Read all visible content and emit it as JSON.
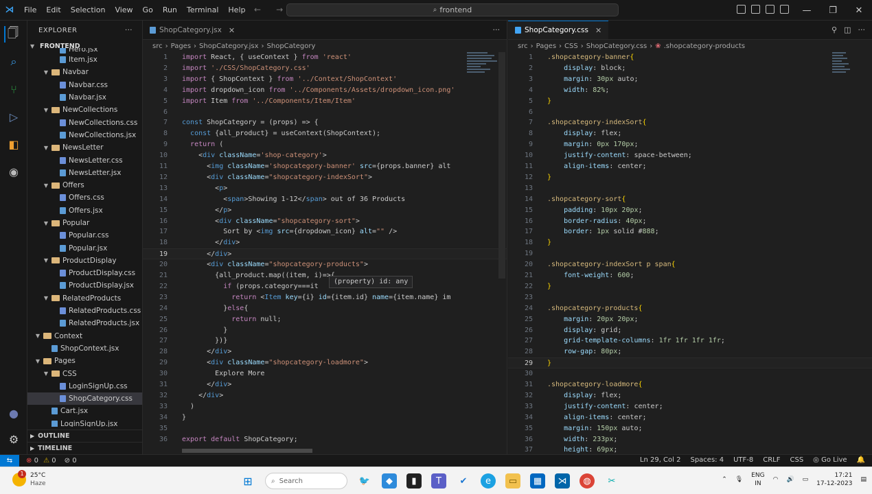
{
  "titlebar": {
    "menu": [
      "File",
      "Edit",
      "Selection",
      "View",
      "Go",
      "Run",
      "Terminal",
      "Help"
    ],
    "command_center": "frontend"
  },
  "sidebar": {
    "title": "EXPLORER",
    "root": "FRONTEND",
    "tree": [
      {
        "label": "Hero.jsx",
        "type": "js",
        "depth": 2,
        "partial": true
      },
      {
        "label": "Item.jsx",
        "type": "js",
        "depth": 2
      },
      {
        "label": "Navbar",
        "type": "folder",
        "depth": 1
      },
      {
        "label": "Navbar.css",
        "type": "css",
        "depth": 2
      },
      {
        "label": "Navbar.jsx",
        "type": "js",
        "depth": 2
      },
      {
        "label": "NewCollections",
        "type": "folder",
        "depth": 1
      },
      {
        "label": "NewCollections.css",
        "type": "css",
        "depth": 2
      },
      {
        "label": "NewCollections.jsx",
        "type": "js",
        "depth": 2
      },
      {
        "label": "NewsLetter",
        "type": "folder",
        "depth": 1
      },
      {
        "label": "NewsLetter.css",
        "type": "css",
        "depth": 2
      },
      {
        "label": "NewsLetter.jsx",
        "type": "js",
        "depth": 2
      },
      {
        "label": "Offers",
        "type": "folder",
        "depth": 1
      },
      {
        "label": "Offers.css",
        "type": "css",
        "depth": 2
      },
      {
        "label": "Offers.jsx",
        "type": "js",
        "depth": 2
      },
      {
        "label": "Popular",
        "type": "folder",
        "depth": 1
      },
      {
        "label": "Popular.css",
        "type": "css",
        "depth": 2
      },
      {
        "label": "Popular.jsx",
        "type": "js",
        "depth": 2
      },
      {
        "label": "ProductDisplay",
        "type": "folder",
        "depth": 1
      },
      {
        "label": "ProductDisplay.css",
        "type": "css",
        "depth": 2
      },
      {
        "label": "ProductDisplay.jsx",
        "type": "js",
        "depth": 2
      },
      {
        "label": "RelatedProducts",
        "type": "folder",
        "depth": 1
      },
      {
        "label": "RelatedProducts.css",
        "type": "css",
        "depth": 2
      },
      {
        "label": "RelatedProducts.jsx",
        "type": "js",
        "depth": 2
      },
      {
        "label": "Context",
        "type": "folder",
        "depth": 0
      },
      {
        "label": "ShopContext.jsx",
        "type": "js",
        "depth": 1
      },
      {
        "label": "Pages",
        "type": "folder",
        "depth": 0
      },
      {
        "label": "CSS",
        "type": "folder",
        "depth": 1
      },
      {
        "label": "LoginSignUp.css",
        "type": "css",
        "depth": 2
      },
      {
        "label": "ShopCategory.css",
        "type": "css",
        "depth": 2,
        "selected": true
      },
      {
        "label": "Cart.jsx",
        "type": "js",
        "depth": 1
      },
      {
        "label": "LoginSignUp.jsx",
        "type": "js",
        "depth": 1,
        "partial": true
      }
    ],
    "outline": "OUTLINE",
    "timeline": "TIMELINE"
  },
  "editor_left": {
    "tab": "ShopCategory.jsx",
    "breadcrumb": [
      "src",
      "Pages",
      "ShopCategory.jsx",
      "ShopCategory"
    ],
    "hover": "(property) id: any",
    "lines": [
      {
        "n": "1",
        "t": "import React, { useContext } from 'react'"
      },
      {
        "n": "2",
        "t": "import './CSS/ShopCategory.css'"
      },
      {
        "n": "3",
        "t": "import { ShopContext } from '../Context/ShopContext'"
      },
      {
        "n": "4",
        "t": "import dropdown_icon from '../Components/Assets/dropdown_icon.png'"
      },
      {
        "n": "5",
        "t": "import Item from '../Components/Item/Item'"
      },
      {
        "n": "6",
        "t": ""
      },
      {
        "n": "7",
        "t": "const ShopCategory = (props) => {"
      },
      {
        "n": "8",
        "t": "  const {all_product} = useContext(ShopContext);"
      },
      {
        "n": "9",
        "t": "  return ("
      },
      {
        "n": "10",
        "t": "    <div className='shop-category'>"
      },
      {
        "n": "11",
        "t": "      <img className='shopcategory-banner' src={props.banner} alt"
      },
      {
        "n": "12",
        "t": "      <div className=\"shopcategory-indexSort\">"
      },
      {
        "n": "13",
        "t": "        <p>"
      },
      {
        "n": "14",
        "t": "          <span>Showing 1-12</span> out of 36 Products"
      },
      {
        "n": "15",
        "t": "        </p>"
      },
      {
        "n": "16",
        "t": "        <div className=\"shopcategory-sort\">"
      },
      {
        "n": "17",
        "t": "          Sort by <img src={dropdown_icon} alt=\"\" />"
      },
      {
        "n": "18",
        "t": "        </div>"
      },
      {
        "n": "19",
        "t": "      </div>"
      },
      {
        "n": "20",
        "t": "      <div className=\"shopcategory-products\">"
      },
      {
        "n": "21",
        "t": "        {all_product.map((item, i)=>{"
      },
      {
        "n": "22",
        "t": "          if (props.category===it"
      },
      {
        "n": "23",
        "t": "            return <Item key={i} id={item.id} name={item.name} im"
      },
      {
        "n": "24",
        "t": "          }else{"
      },
      {
        "n": "25",
        "t": "            return null;"
      },
      {
        "n": "26",
        "t": "          }"
      },
      {
        "n": "27",
        "t": "        })}"
      },
      {
        "n": "28",
        "t": "      </div>"
      },
      {
        "n": "29",
        "t": "      <div className=\"shopcategory-loadmore\">"
      },
      {
        "n": "30",
        "t": "        Explore More"
      },
      {
        "n": "31",
        "t": "      </div>"
      },
      {
        "n": "32",
        "t": "    </div>"
      },
      {
        "n": "33",
        "t": "  )"
      },
      {
        "n": "34",
        "t": "}"
      },
      {
        "n": "35",
        "t": ""
      },
      {
        "n": "36",
        "t": "export default ShopCategory;"
      }
    ]
  },
  "editor_right": {
    "tab": "ShopCategory.css",
    "breadcrumb": [
      "src",
      "Pages",
      "CSS",
      "ShopCategory.css",
      ".shopcategory-products"
    ],
    "lines": [
      {
        "n": "1",
        "t": ".shopcategory-banner{"
      },
      {
        "n": "2",
        "t": "    display: block;"
      },
      {
        "n": "3",
        "t": "    margin: 30px auto;"
      },
      {
        "n": "4",
        "t": "    width: 82%;"
      },
      {
        "n": "5",
        "t": "}"
      },
      {
        "n": "6",
        "t": ""
      },
      {
        "n": "7",
        "t": ".shopcategory-indexSort{"
      },
      {
        "n": "8",
        "t": "    display: flex;"
      },
      {
        "n": "9",
        "t": "    margin: 0px 170px;"
      },
      {
        "n": "10",
        "t": "    justify-content: space-between;"
      },
      {
        "n": "11",
        "t": "    align-items: center;"
      },
      {
        "n": "12",
        "t": "}"
      },
      {
        "n": "13",
        "t": ""
      },
      {
        "n": "14",
        "t": ".shopcategory-sort{"
      },
      {
        "n": "15",
        "t": "    padding: 10px 20px;"
      },
      {
        "n": "16",
        "t": "    border-radius: 40px;"
      },
      {
        "n": "17",
        "t": "    border: 1px solid #888;"
      },
      {
        "n": "18",
        "t": "}"
      },
      {
        "n": "19",
        "t": ""
      },
      {
        "n": "20",
        "t": ".shopcategory-indexSort p span{"
      },
      {
        "n": "21",
        "t": "    font-weight: 600;"
      },
      {
        "n": "22",
        "t": "}"
      },
      {
        "n": "23",
        "t": ""
      },
      {
        "n": "24",
        "t": ".shopcategory-products{"
      },
      {
        "n": "25",
        "t": "    margin: 20px 20px;"
      },
      {
        "n": "26",
        "t": "    display: grid;"
      },
      {
        "n": "27",
        "t": "    grid-template-columns: 1fr 1fr 1fr 1fr;"
      },
      {
        "n": "28",
        "t": "    row-gap: 80px;"
      },
      {
        "n": "29",
        "t": "}"
      },
      {
        "n": "30",
        "t": ""
      },
      {
        "n": "31",
        "t": ".shopcategory-loadmore{"
      },
      {
        "n": "32",
        "t": "    display: flex;"
      },
      {
        "n": "33",
        "t": "    justify-content: center;"
      },
      {
        "n": "34",
        "t": "    align-items: center;"
      },
      {
        "n": "35",
        "t": "    margin: 150px auto;"
      },
      {
        "n": "36",
        "t": "    width: 233px;"
      },
      {
        "n": "37",
        "t": "    height: 69px;"
      }
    ]
  },
  "status": {
    "errors": "0",
    "warnings": "0",
    "ports": "0",
    "position": "Ln 29, Col 2",
    "spaces": "Spaces: 4",
    "encoding": "UTF-8",
    "eol": "CRLF",
    "language": "CSS",
    "golive": "Go Live"
  },
  "taskbar": {
    "weather_temp": "25°C",
    "weather_desc": "Haze",
    "weather_badge": "1",
    "search_placeholder": "Search",
    "lang1": "ENG",
    "lang2": "IN",
    "time": "17:21",
    "date": "17-12-2023"
  },
  "colors": {
    "accent": "#0078d4",
    "folder": "#dcb67a",
    "bg": "#1e1e1e"
  }
}
